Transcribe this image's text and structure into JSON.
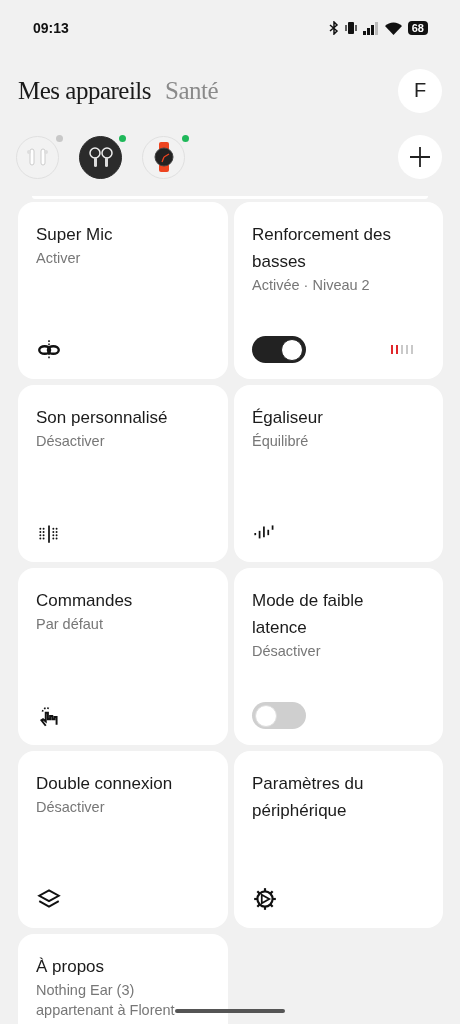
{
  "status_bar": {
    "time": "09:13",
    "battery": "68"
  },
  "tabs": [
    {
      "label": "Mes appareils",
      "selected": true
    },
    {
      "label": "Santé",
      "selected": false
    }
  ],
  "avatar": {
    "initial": "F"
  },
  "devices": [
    {
      "kind": "buds-white",
      "selected": false,
      "color": "#c8c8c8"
    },
    {
      "kind": "buds-clear",
      "selected": true,
      "color": "#1fb85a"
    },
    {
      "kind": "watch",
      "selected": false,
      "color": "#1fb85a"
    }
  ],
  "tiles": [
    {
      "title": "Super Mic",
      "subtitle": "Activer",
      "kind": "mic-link"
    },
    {
      "title": "Renforcement des basses",
      "subtitle": "Activée · Niveau 2",
      "control": {
        "kind": "toggle",
        "on": true
      },
      "meter": {
        "level": 0.4
      }
    },
    {
      "title": "Son personnalisé",
      "subtitle": "Désactiver",
      "kind": "dot-grid"
    },
    {
      "title": "Égaliseur",
      "subtitle": "Équilibré",
      "kind": "waveform"
    },
    {
      "title": "Commandes",
      "subtitle": "Par défaut",
      "kind": "hand-tap"
    },
    {
      "title": "Mode de faible latence",
      "subtitle": "Désactiver",
      "control": {
        "kind": "toggle",
        "on": false
      }
    },
    {
      "title": "Double connexion",
      "subtitle": "Désactiver",
      "kind": "layers"
    },
    {
      "title": "Paramètres du périphérique",
      "kind": "gear"
    },
    {
      "title": "À propos",
      "subtitle": "Nothing Ear (3)",
      "note": "appartenant à Florent"
    }
  ]
}
